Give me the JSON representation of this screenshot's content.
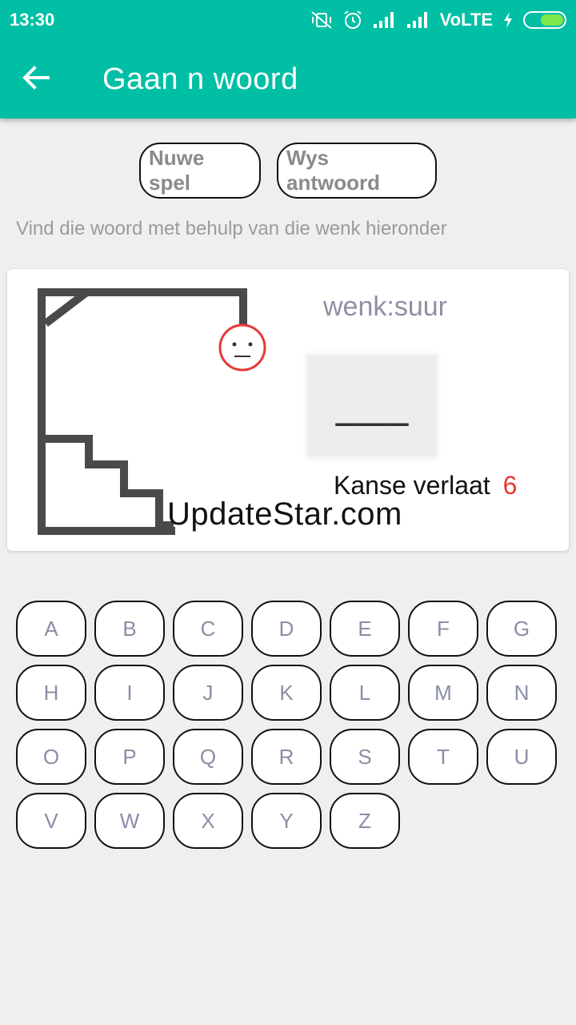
{
  "status_bar": {
    "time": "13:30",
    "network_label": "VoLTE",
    "icons": [
      "vibrate-off-icon",
      "alarm-icon",
      "signal-icon",
      "signal-icon",
      "charging-icon",
      "battery-icon"
    ]
  },
  "toolbar": {
    "back_icon": "arrow-left-icon",
    "title": "Gaan n woord"
  },
  "colors": {
    "accent": "#00bfa5",
    "background": "#efefef",
    "chances_count": "#e53935",
    "face": "#e53935"
  },
  "actions": {
    "new_game": "Nuwe spel",
    "show_answer": "Wys antwoord"
  },
  "instruction": "Vind die woord met behulp van die wenk hieronder",
  "game": {
    "hint": "wenk:suur",
    "masked_word": "____",
    "chances_label": "Kanse verlaat",
    "chances_count": "6"
  },
  "watermark": "UpdateStar.com",
  "keyboard": {
    "keys": [
      "A",
      "B",
      "C",
      "D",
      "E",
      "F",
      "G",
      "H",
      "I",
      "J",
      "K",
      "L",
      "M",
      "N",
      "O",
      "P",
      "Q",
      "R",
      "S",
      "T",
      "U",
      "V",
      "W",
      "X",
      "Y",
      "Z"
    ]
  }
}
